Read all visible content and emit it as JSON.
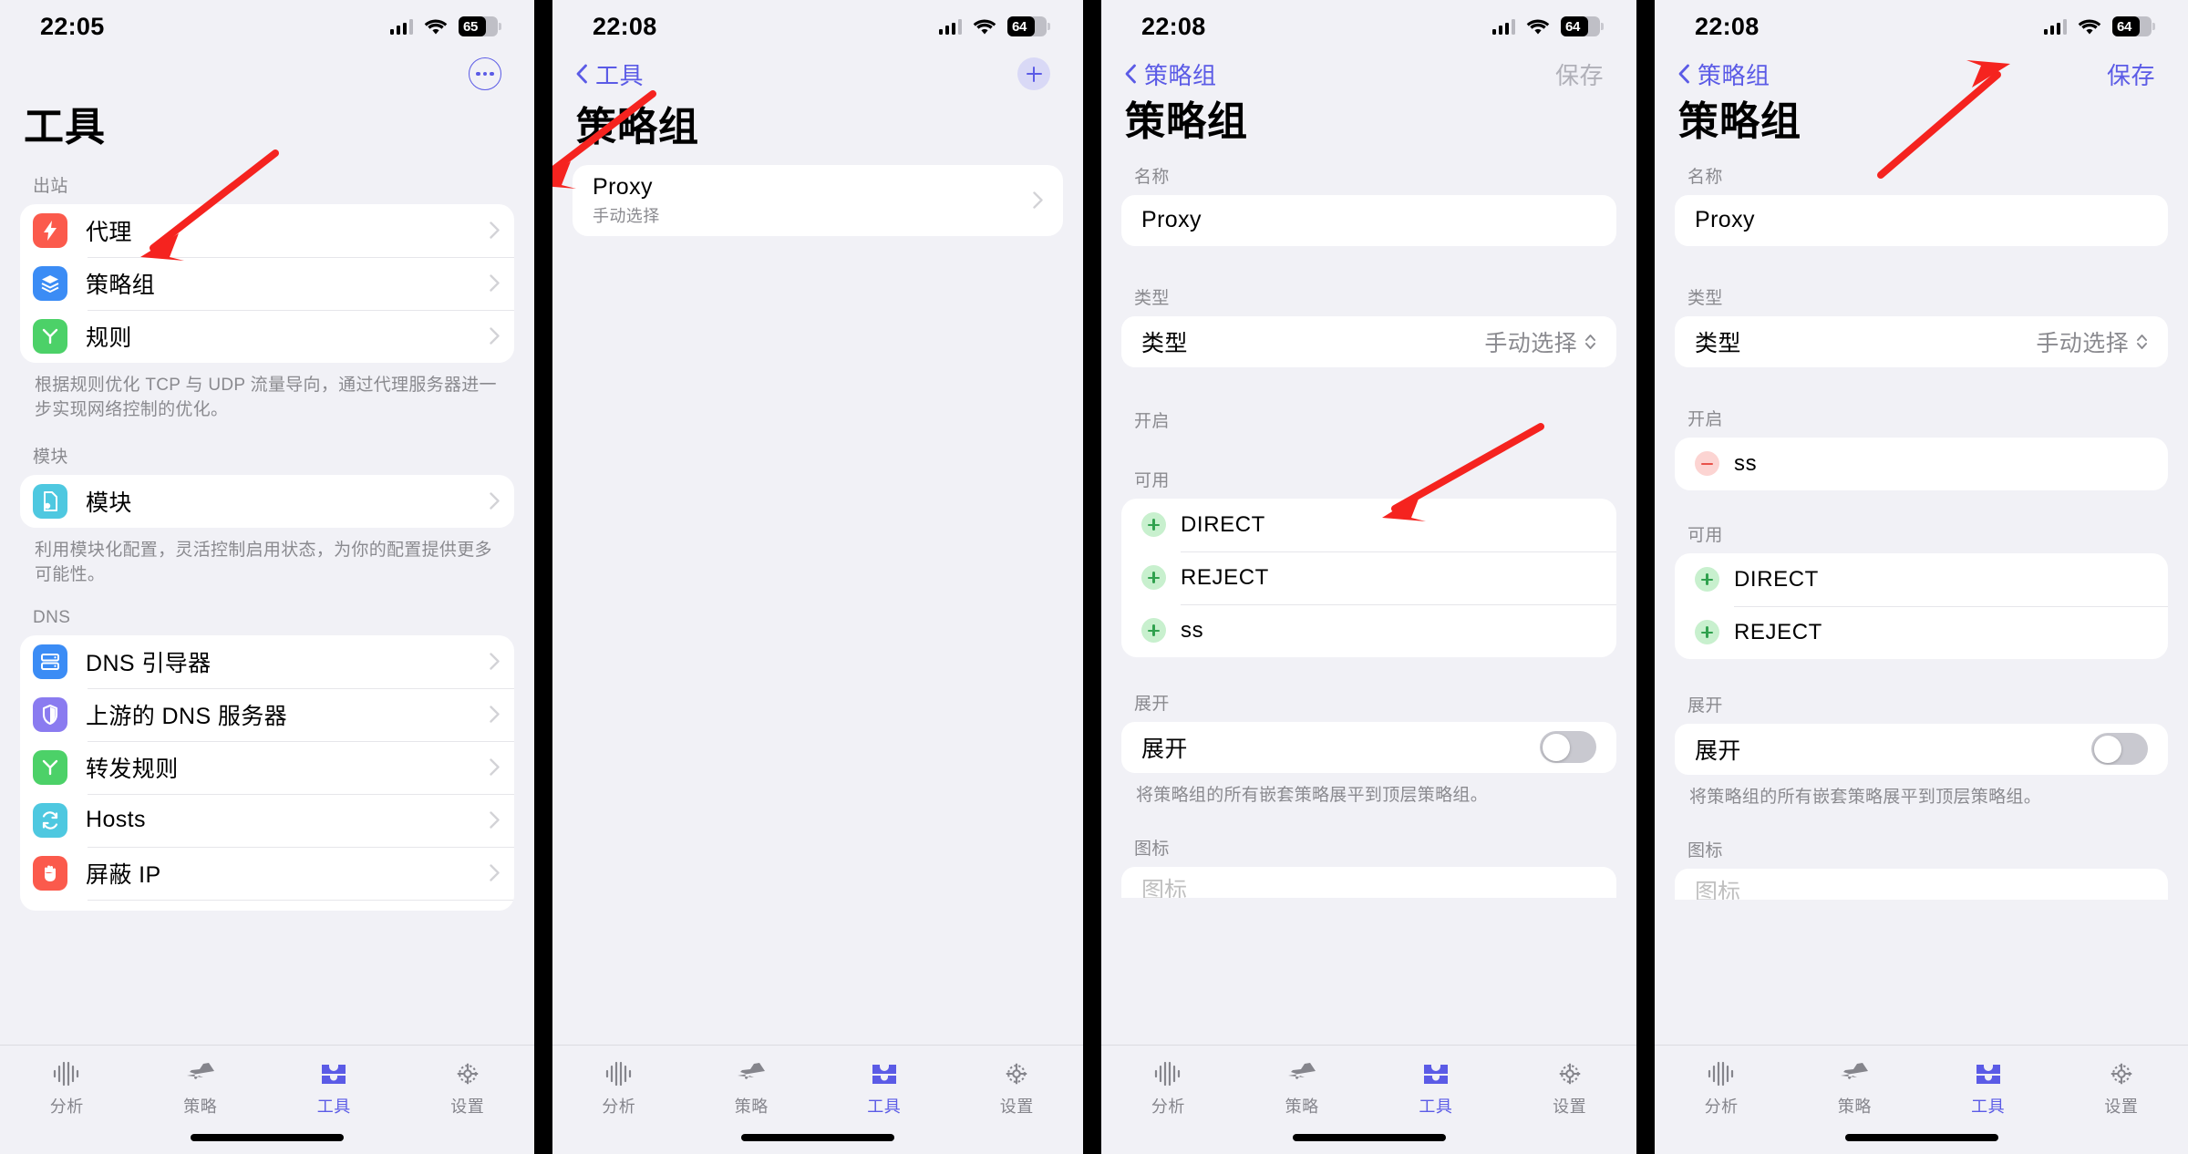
{
  "panels": [
    {
      "id": "tools",
      "status": {
        "time": "22:05",
        "battery": "65"
      },
      "title": "工具",
      "more_button": "more-options",
      "sections": [
        {
          "label": "出站",
          "rows": [
            {
              "label": "代理",
              "icon": "bolt-icon",
              "color": "#fb5a4c"
            },
            {
              "label": "策略组",
              "icon": "layers-icon",
              "color": "#3b8cf5"
            },
            {
              "label": "规则",
              "icon": "branch-icon",
              "color": "#4cd168"
            }
          ],
          "footnote": "根据规则优化 TCP 与 UDP 流量导向，通过代理服务器进一步实现网络控制的优化。"
        },
        {
          "label": "模块",
          "rows": [
            {
              "label": "模块",
              "icon": "document-gear-icon",
              "color": "#4ec8e0"
            }
          ],
          "footnote": "利用模块化配置，灵活控制启用状态，为你的配置提供更多可能性。"
        },
        {
          "label": "DNS",
          "rows": [
            {
              "label": "DNS 引导器",
              "icon": "server-icon",
              "color": "#3b8cf5"
            },
            {
              "label": "上游的 DNS 服务器",
              "icon": "shield-icon",
              "color": "#8a7bf0"
            },
            {
              "label": "转发规则",
              "icon": "branch-icon",
              "color": "#4cd168"
            },
            {
              "label": "Hosts",
              "icon": "sync-icon",
              "color": "#4ec8e0"
            },
            {
              "label": "屏蔽 IP",
              "icon": "hand-icon",
              "color": "#fb5a4c"
            }
          ],
          "footnote": ""
        }
      ]
    },
    {
      "id": "policy-groups",
      "status": {
        "time": "22:08",
        "battery": "64"
      },
      "back_label": "工具",
      "add_button": "add-policy-group",
      "title": "策略组",
      "group_row": {
        "name": "Proxy",
        "subtitle": "手动选择"
      }
    },
    {
      "id": "policy-group-edit-before",
      "status": {
        "time": "22:08",
        "battery": "64"
      },
      "back_label": "策略组",
      "save_label": "保存",
      "save_enabled": false,
      "title": "策略组",
      "name_label": "名称",
      "name_value": "Proxy",
      "type_label": "类型",
      "type_row_key": "类型",
      "type_value": "手动选择",
      "enabled_label": "开启",
      "enabled_items": [],
      "available_label": "可用",
      "available_items": [
        "DIRECT",
        "REJECT",
        "ss"
      ],
      "expand_label": "展开",
      "expand_row_key": "展开",
      "expand_on": false,
      "expand_footnote": "将策略组的所有嵌套策略展平到顶层策略组。",
      "icon_label": "图标",
      "icon_row_key": "图标"
    },
    {
      "id": "policy-group-edit-after",
      "status": {
        "time": "22:08",
        "battery": "64"
      },
      "back_label": "策略组",
      "save_label": "保存",
      "save_enabled": true,
      "title": "策略组",
      "name_label": "名称",
      "name_value": "Proxy",
      "type_label": "类型",
      "type_row_key": "类型",
      "type_value": "手动选择",
      "enabled_label": "开启",
      "enabled_items": [
        "ss"
      ],
      "available_label": "可用",
      "available_items": [
        "DIRECT",
        "REJECT"
      ],
      "expand_label": "展开",
      "expand_row_key": "展开",
      "expand_on": false,
      "expand_footnote": "将策略组的所有嵌套策略展平到顶层策略组。",
      "icon_label": "图标",
      "icon_row_key": "图标"
    }
  ],
  "tabbar": {
    "tabs": [
      {
        "label": "分析",
        "icon": "waveform-icon",
        "active": false
      },
      {
        "label": "策略",
        "icon": "airplane-icon",
        "active": false
      },
      {
        "label": "工具",
        "icon": "toolbox-icon",
        "active": true
      },
      {
        "label": "设置",
        "icon": "gear-icon",
        "active": false
      }
    ],
    "accent": "#5b5be6"
  },
  "annotations": {
    "arrow_color": "#f5231f",
    "arrows": [
      {
        "target": "tools-row-policy-groups"
      },
      {
        "target": "policy-group-proxy-row"
      },
      {
        "target": "available-item-ss"
      },
      {
        "target": "save-button"
      }
    ]
  }
}
